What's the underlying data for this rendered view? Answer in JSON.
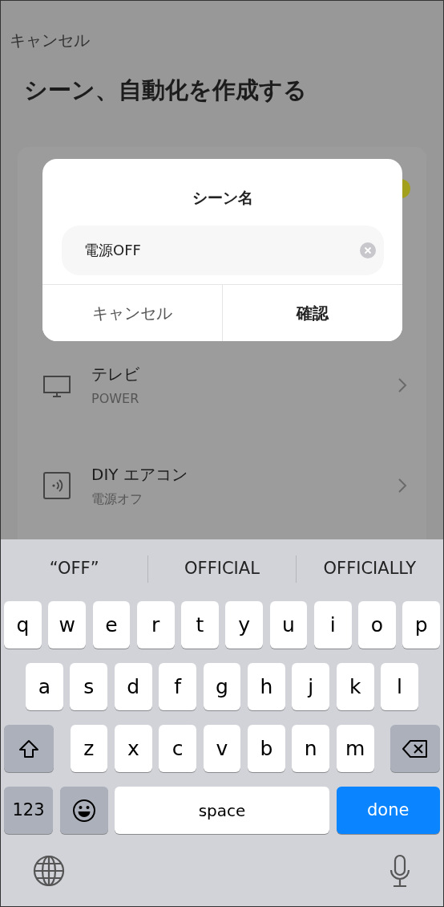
{
  "header": {
    "back_label": "キャンセル",
    "title": "シーン、自動化を作成する"
  },
  "actions": [
    {
      "device": "テレビ",
      "command": "POWER",
      "kind": "tv"
    },
    {
      "device": "DIY エアコン",
      "command": "電源オフ",
      "kind": "remote"
    }
  ],
  "dialog": {
    "title": "シーン名",
    "value": "電源OFF",
    "buttons": [
      {
        "label": "キャンセル",
        "kind": "cancel"
      },
      {
        "label": "確認",
        "kind": "confirm"
      }
    ]
  },
  "keyboard": {
    "suggestions": [
      "“OFF”",
      "OFFICIAL",
      "OFFICIALLY"
    ],
    "rows": [
      [
        {
          "kind": "letter",
          "label": "q"
        },
        {
          "kind": "letter",
          "label": "w"
        },
        {
          "kind": "letter",
          "label": "e"
        },
        {
          "kind": "letter",
          "label": "r"
        },
        {
          "kind": "letter",
          "label": "t"
        },
        {
          "kind": "letter",
          "label": "y"
        },
        {
          "kind": "letter",
          "label": "u"
        },
        {
          "kind": "letter",
          "label": "i"
        },
        {
          "kind": "letter",
          "label": "o"
        },
        {
          "kind": "letter",
          "label": "p"
        }
      ],
      [
        {
          "kind": "letter",
          "label": "a"
        },
        {
          "kind": "letter",
          "label": "s"
        },
        {
          "kind": "letter",
          "label": "d"
        },
        {
          "kind": "letter",
          "label": "f"
        },
        {
          "kind": "letter",
          "label": "g"
        },
        {
          "kind": "letter",
          "label": "h"
        },
        {
          "kind": "letter",
          "label": "j"
        },
        {
          "kind": "letter",
          "label": "k"
        },
        {
          "kind": "letter",
          "label": "l"
        }
      ],
      [
        {
          "kind": "shift"
        },
        {
          "kind": "letter",
          "label": "z"
        },
        {
          "kind": "letter",
          "label": "x"
        },
        {
          "kind": "letter",
          "label": "c"
        },
        {
          "kind": "letter",
          "label": "v"
        },
        {
          "kind": "letter",
          "label": "b"
        },
        {
          "kind": "letter",
          "label": "n"
        },
        {
          "kind": "letter",
          "label": "m"
        },
        {
          "kind": "backspace"
        }
      ]
    ],
    "bottom_keys": [
      {
        "kind": "numbers",
        "label": "123"
      },
      {
        "kind": "emoji"
      },
      {
        "kind": "space",
        "label": "space"
      },
      {
        "kind": "done",
        "label": "done"
      }
    ]
  }
}
